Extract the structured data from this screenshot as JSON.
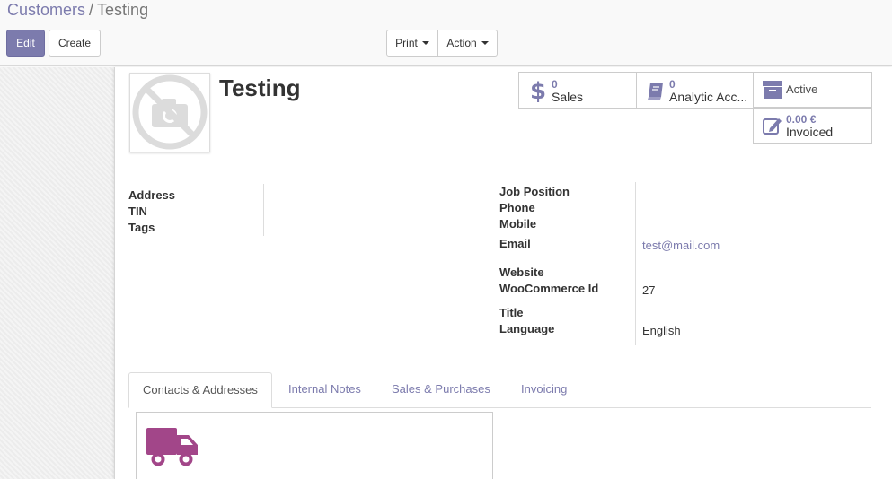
{
  "breadcrumb": {
    "parent": "Customers",
    "separator": "/",
    "current": "Testing"
  },
  "toolbar": {
    "edit_label": "Edit",
    "create_label": "Create",
    "print_label": "Print",
    "action_label": "Action"
  },
  "record": {
    "title": "Testing"
  },
  "stat_buttons": {
    "sales": {
      "value": "0",
      "label": "Sales",
      "icon": "dollar-icon"
    },
    "analytic": {
      "value": "0",
      "label": "Analytic Acc...",
      "icon": "book-icon"
    },
    "active": {
      "label": "Active",
      "icon": "archive-icon"
    },
    "invoiced": {
      "value": "0.00 €",
      "label": "Invoiced",
      "icon": "edit-icon"
    }
  },
  "left_fields": {
    "address_label": "Address",
    "tin_label": "TIN",
    "tags_label": "Tags"
  },
  "right_fields": {
    "job_position_label": "Job Position",
    "phone_label": "Phone",
    "mobile_label": "Mobile",
    "email_label": "Email",
    "email_value": "test@mail.com",
    "website_label": "Website",
    "woocommerce_label": "WooCommerce Id",
    "woocommerce_value": "27",
    "title_label": "Title",
    "language_label": "Language",
    "language_value": "English"
  },
  "tabs": [
    {
      "label": "Contacts & Addresses",
      "active": true
    },
    {
      "label": "Internal Notes",
      "active": false
    },
    {
      "label": "Sales & Purchases",
      "active": false
    },
    {
      "label": "Invoicing",
      "active": false
    }
  ],
  "colors": {
    "accent": "#7c7bad",
    "truck": "#a24689",
    "edit_button": "#7c7bad"
  }
}
